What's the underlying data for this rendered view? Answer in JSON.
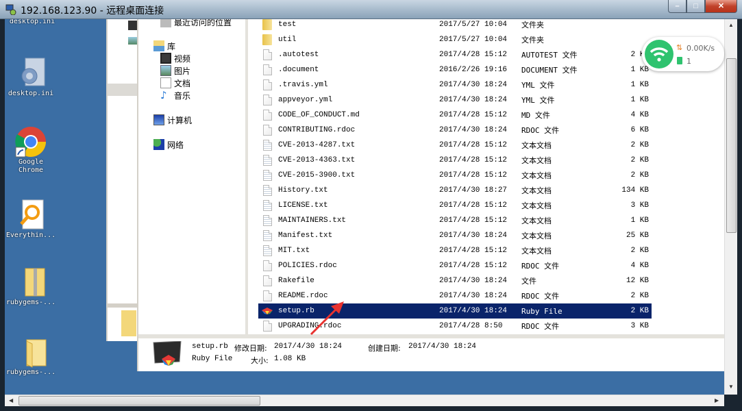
{
  "window": {
    "title": "192.168.123.90 - 远程桌面连接",
    "buttons": {
      "minimize": "–",
      "maximize": "□",
      "close": "✕"
    }
  },
  "desktop": {
    "icons": [
      {
        "label": "desktop.ini",
        "icon": "settings-file-icon",
        "partial": true
      },
      {
        "label": "desktop.ini",
        "icon": "settings-file-icon"
      },
      {
        "label": "Google Chrome",
        "icon": "chrome-icon"
      },
      {
        "label": "Everythin...",
        "icon": "everything-search-icon"
      },
      {
        "label": "rubygems-...",
        "icon": "zip-folder-icon"
      },
      {
        "label": "rubygems-...",
        "icon": "folder-icon"
      }
    ]
  },
  "nav": {
    "recent": "最近访问的位置",
    "library": "库",
    "library_items": [
      "视频",
      "图片",
      "文档",
      "音乐"
    ],
    "computer": "计算机",
    "network": "网络"
  },
  "files": [
    {
      "name": "test",
      "date": "2017/5/27 10:04",
      "type": "文件夹",
      "size": "",
      "icon": "folder"
    },
    {
      "name": "util",
      "date": "2017/5/27 10:04",
      "type": "文件夹",
      "size": "",
      "icon": "folder"
    },
    {
      "name": ".autotest",
      "date": "2017/4/28 15:12",
      "type": "AUTOTEST 文件",
      "size": "2 KB",
      "icon": "file"
    },
    {
      "name": ".document",
      "date": "2016/2/26 19:16",
      "type": "DOCUMENT 文件",
      "size": "1 KB",
      "icon": "file"
    },
    {
      "name": ".travis.yml",
      "date": "2017/4/30 18:24",
      "type": "YML 文件",
      "size": "1 KB",
      "icon": "file"
    },
    {
      "name": "appveyor.yml",
      "date": "2017/4/30 18:24",
      "type": "YML 文件",
      "size": "1 KB",
      "icon": "file"
    },
    {
      "name": "CODE_OF_CONDUCT.md",
      "date": "2017/4/28 15:12",
      "type": "MD 文件",
      "size": "4 KB",
      "icon": "file"
    },
    {
      "name": "CONTRIBUTING.rdoc",
      "date": "2017/4/30 18:24",
      "type": "RDOC 文件",
      "size": "6 KB",
      "icon": "file"
    },
    {
      "name": "CVE-2013-4287.txt",
      "date": "2017/4/28 15:12",
      "type": "文本文档",
      "size": "2 KB",
      "icon": "txt"
    },
    {
      "name": "CVE-2013-4363.txt",
      "date": "2017/4/28 15:12",
      "type": "文本文档",
      "size": "2 KB",
      "icon": "txt"
    },
    {
      "name": "CVE-2015-3900.txt",
      "date": "2017/4/28 15:12",
      "type": "文本文档",
      "size": "2 KB",
      "icon": "txt"
    },
    {
      "name": "History.txt",
      "date": "2017/4/30 18:27",
      "type": "文本文档",
      "size": "134 KB",
      "icon": "txt"
    },
    {
      "name": "LICENSE.txt",
      "date": "2017/4/28 15:12",
      "type": "文本文档",
      "size": "3 KB",
      "icon": "txt"
    },
    {
      "name": "MAINTAINERS.txt",
      "date": "2017/4/28 15:12",
      "type": "文本文档",
      "size": "1 KB",
      "icon": "txt"
    },
    {
      "name": "Manifest.txt",
      "date": "2017/4/30 18:24",
      "type": "文本文档",
      "size": "25 KB",
      "icon": "txt"
    },
    {
      "name": "MIT.txt",
      "date": "2017/4/28 15:12",
      "type": "文本文档",
      "size": "2 KB",
      "icon": "txt"
    },
    {
      "name": "POLICIES.rdoc",
      "date": "2017/4/28 15:12",
      "type": "RDOC 文件",
      "size": "4 KB",
      "icon": "file"
    },
    {
      "name": "Rakefile",
      "date": "2017/4/30 18:24",
      "type": "文件",
      "size": "12 KB",
      "icon": "file"
    },
    {
      "name": "README.rdoc",
      "date": "2017/4/30 18:24",
      "type": "RDOC 文件",
      "size": "2 KB",
      "icon": "file"
    },
    {
      "name": "setup.rb",
      "date": "2017/4/30 18:24",
      "type": "Ruby File",
      "size": "2 KB",
      "icon": "ruby",
      "selected": true
    },
    {
      "name": "UPGRADING.rdoc",
      "date": "2017/4/28 8:50",
      "type": "RDOC 文件",
      "size": "3 KB",
      "icon": "file"
    }
  ],
  "details": {
    "filename": "setup.rb",
    "modified_label": "修改日期:",
    "modified": "2017/4/30 18:24",
    "created_label": "创建日期:",
    "created": "2017/4/30 18:24",
    "type": "Ruby File",
    "size_label": "大小:",
    "size": "1.08 KB"
  },
  "network_widget": {
    "speed": "0.00K/s",
    "devices": "1"
  },
  "colors": {
    "desktop_bg": "#3b6ea4",
    "selection": "#0a246a",
    "wifi_green": "#2fc36f",
    "annotation_arrow": "#e8322f"
  }
}
